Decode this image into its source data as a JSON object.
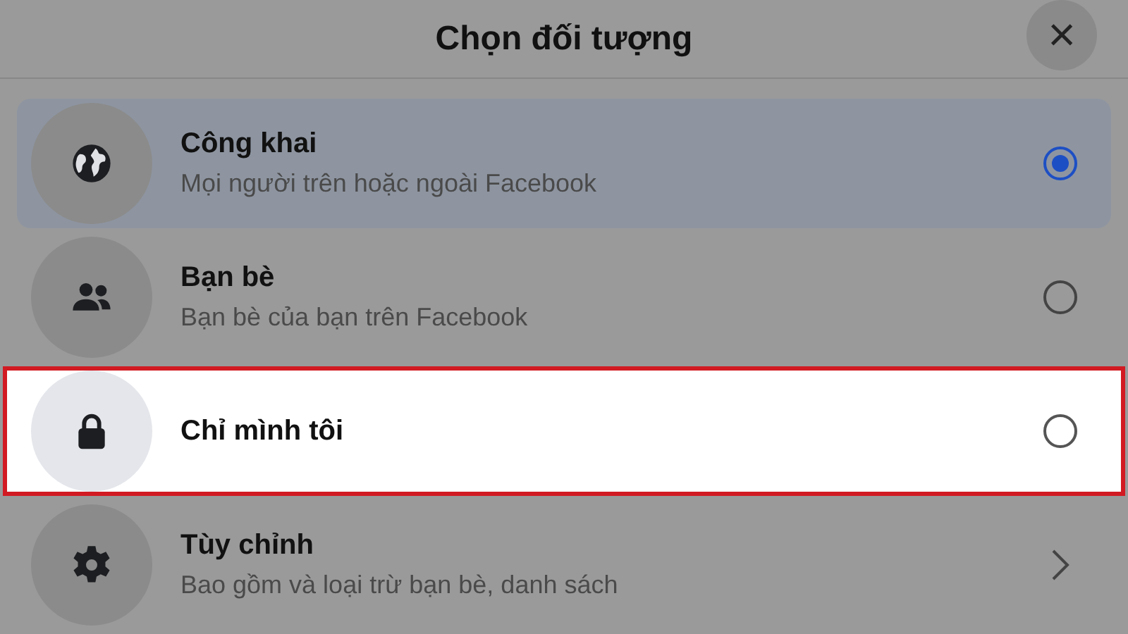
{
  "header": {
    "title": "Chọn đối tượng",
    "close": "×"
  },
  "options": [
    {
      "kind": "radio",
      "label": "Công khai",
      "description": "Mọi người trên hoặc ngoài Facebook",
      "selected": true,
      "highlighted": false
    },
    {
      "kind": "radio",
      "label": "Bạn bè",
      "description": "Bạn bè của bạn trên Facebook",
      "selected": false,
      "highlighted": false
    },
    {
      "kind": "radio",
      "label": "Chỉ mình tôi",
      "selected": false,
      "highlighted": true
    },
    {
      "kind": "submenu",
      "label": "Tùy chỉnh",
      "description": "Bao gồm và loại trừ bạn bè, danh sách",
      "highlighted": false
    }
  ]
}
